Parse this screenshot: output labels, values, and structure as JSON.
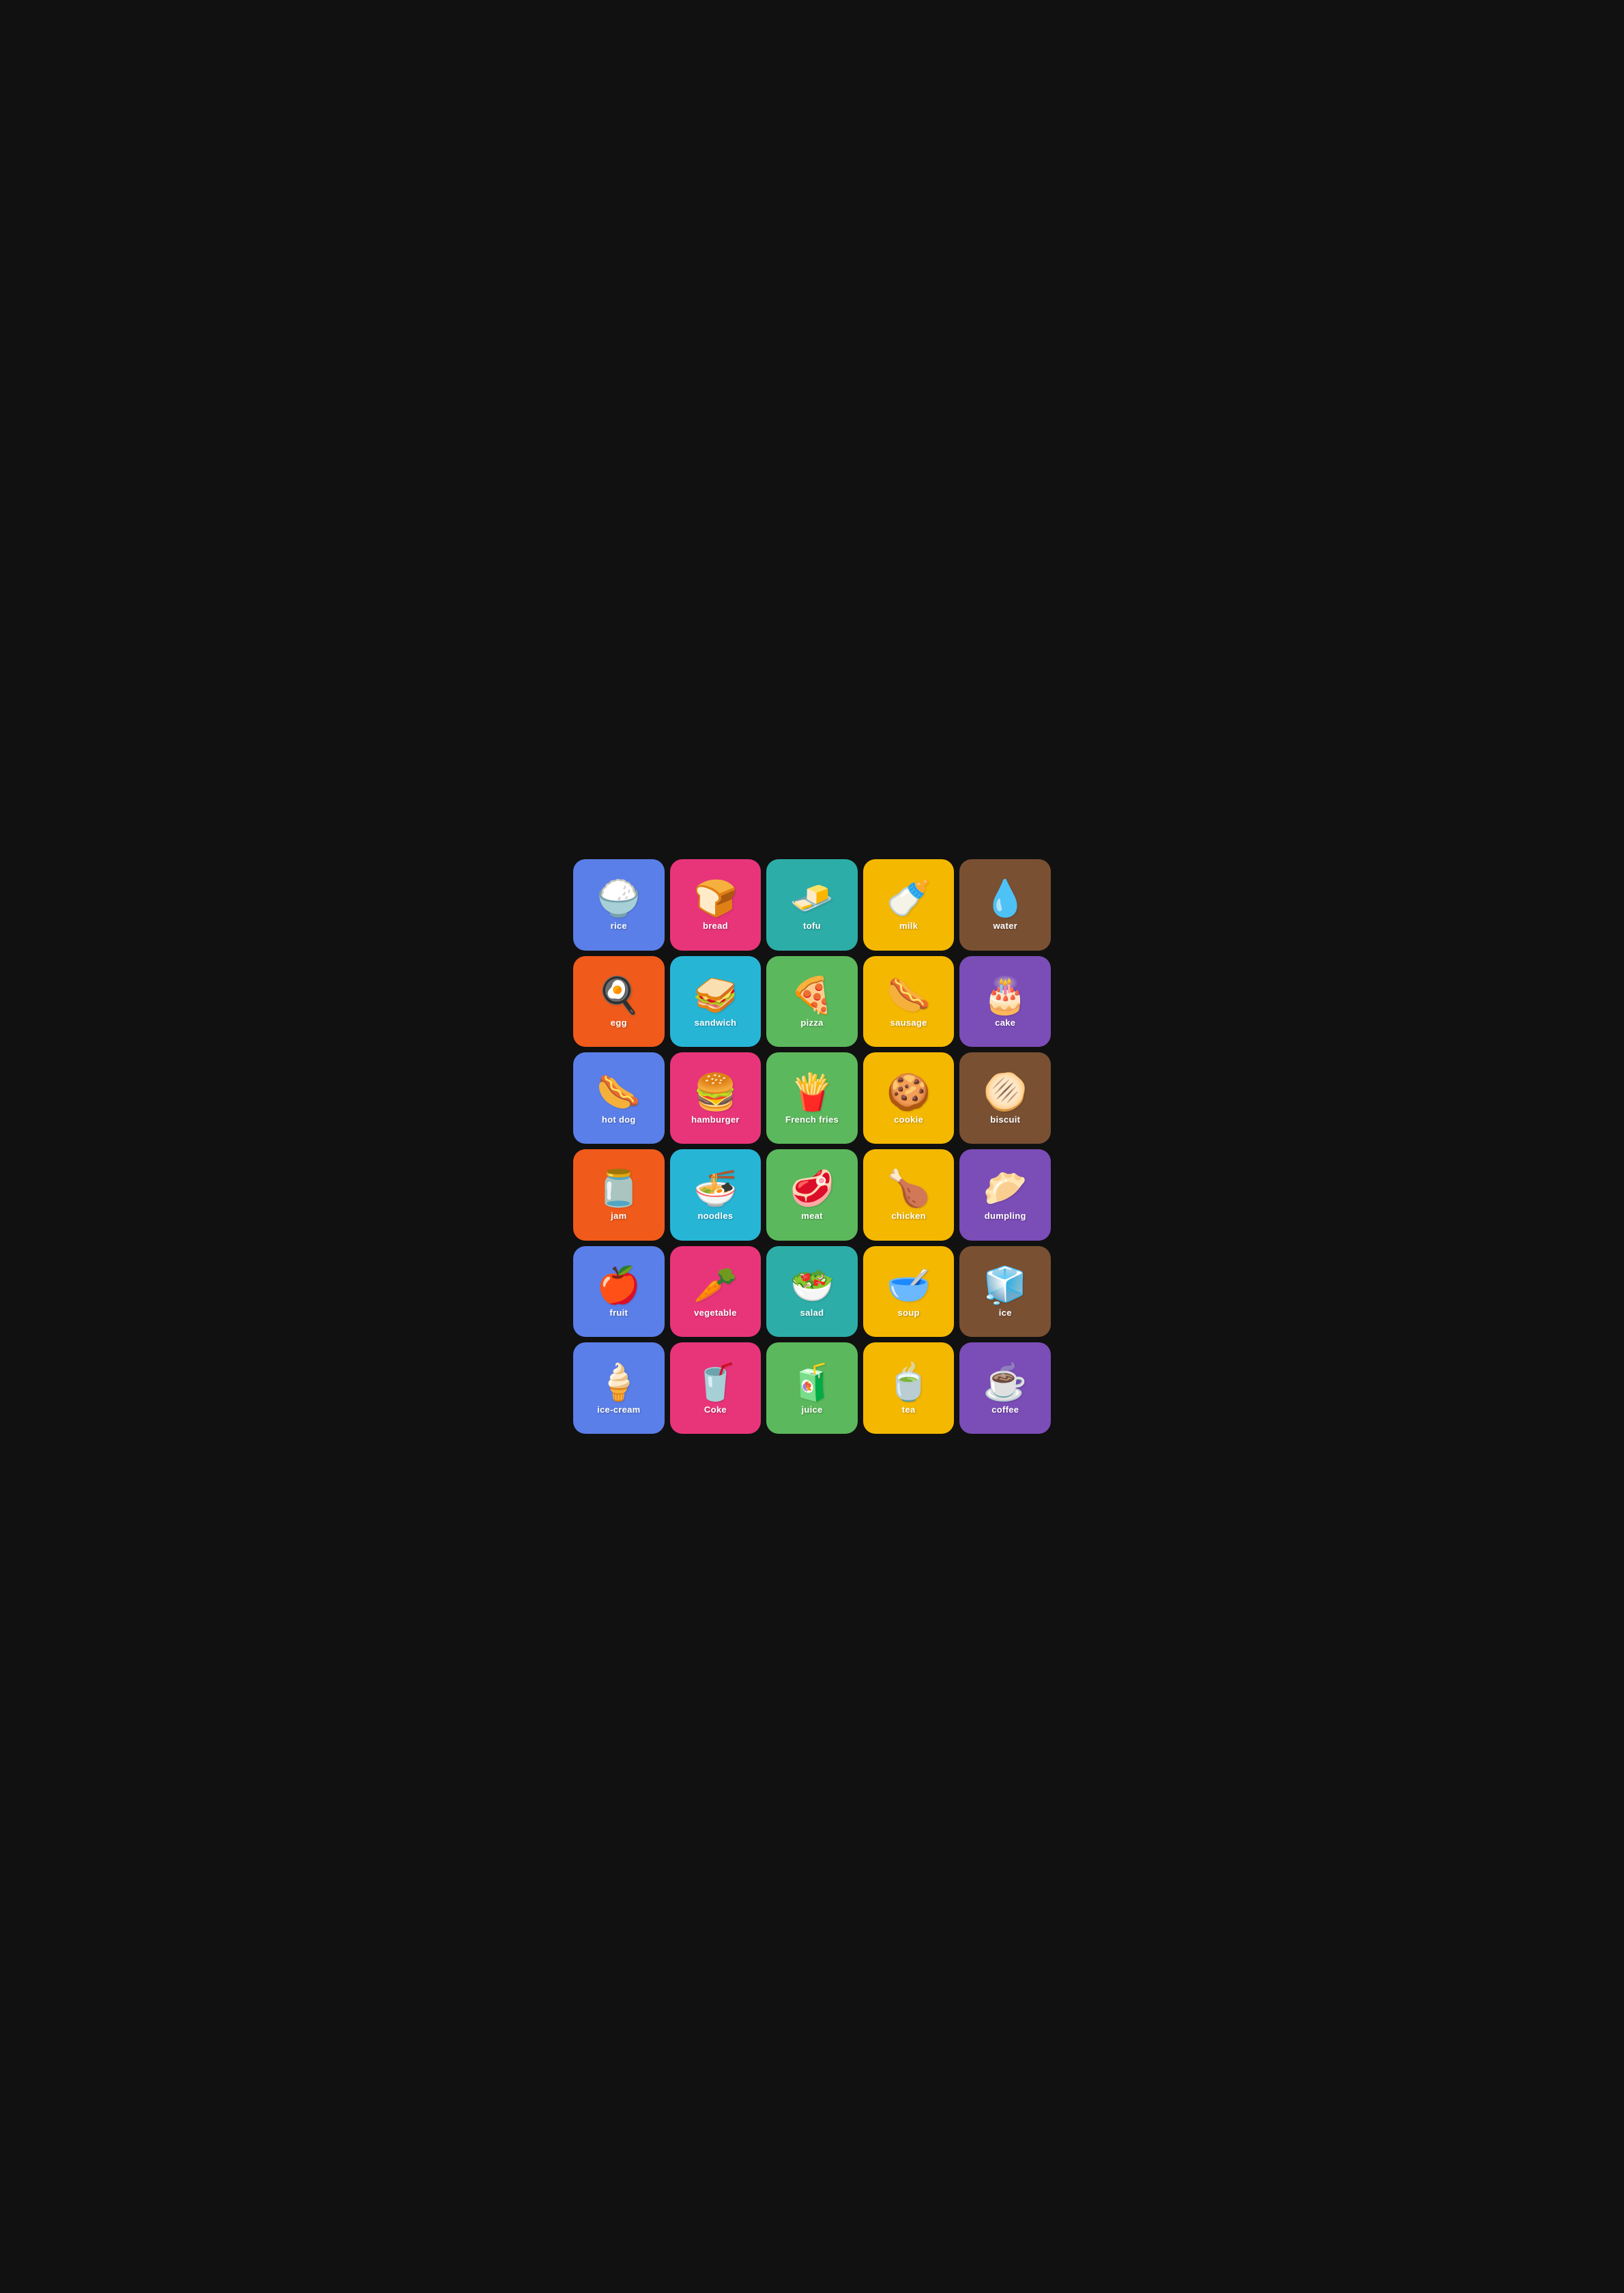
{
  "cards": [
    {
      "id": "rice",
      "label": "rice",
      "icon": "🍚",
      "bg": "bg-blue"
    },
    {
      "id": "bread",
      "label": "bread",
      "icon": "🍞",
      "bg": "bg-pink"
    },
    {
      "id": "tofu",
      "label": "tofu",
      "icon": "🧈",
      "bg": "bg-teal"
    },
    {
      "id": "milk",
      "label": "milk",
      "icon": "🍼",
      "bg": "bg-yellow"
    },
    {
      "id": "water",
      "label": "water",
      "icon": "💧",
      "bg": "bg-brown"
    },
    {
      "id": "egg",
      "label": "egg",
      "icon": "🍳",
      "bg": "bg-orange"
    },
    {
      "id": "sandwich",
      "label": "sandwich",
      "icon": "🥪",
      "bg": "bg-cyan"
    },
    {
      "id": "pizza",
      "label": "pizza",
      "icon": "🍕",
      "bg": "bg-green"
    },
    {
      "id": "sausage",
      "label": "sausage",
      "icon": "🌭",
      "bg": "bg-yellow"
    },
    {
      "id": "cake",
      "label": "cake",
      "icon": "🎂",
      "bg": "bg-purple"
    },
    {
      "id": "hot-dog",
      "label": "hot dog",
      "icon": "🌭",
      "bg": "bg-blue"
    },
    {
      "id": "hamburger",
      "label": "hamburger",
      "icon": "🍔",
      "bg": "bg-pink"
    },
    {
      "id": "french-fries",
      "label": "French fries",
      "icon": "🍟",
      "bg": "bg-green"
    },
    {
      "id": "cookie",
      "label": "cookie",
      "icon": "🍪",
      "bg": "bg-yellow"
    },
    {
      "id": "biscuit",
      "label": "biscuit",
      "icon": "🫓",
      "bg": "bg-brown"
    },
    {
      "id": "jam",
      "label": "jam",
      "icon": "🫙",
      "bg": "bg-orange"
    },
    {
      "id": "noodles",
      "label": "noodles",
      "icon": "🍜",
      "bg": "bg-cyan"
    },
    {
      "id": "meat",
      "label": "meat",
      "icon": "🥩",
      "bg": "bg-green"
    },
    {
      "id": "chicken",
      "label": "chicken",
      "icon": "🍗",
      "bg": "bg-yellow"
    },
    {
      "id": "dumpling",
      "label": "dumpling",
      "icon": "🥟",
      "bg": "bg-purple"
    },
    {
      "id": "fruit",
      "label": "fruit",
      "icon": "🍎",
      "bg": "bg-blue"
    },
    {
      "id": "vegetable",
      "label": "vegetable",
      "icon": "🥕",
      "bg": "bg-pink"
    },
    {
      "id": "salad",
      "label": "salad",
      "icon": "🥗",
      "bg": "bg-teal"
    },
    {
      "id": "soup",
      "label": "soup",
      "icon": "🥣",
      "bg": "bg-yellow"
    },
    {
      "id": "ice",
      "label": "ice",
      "icon": "🧊",
      "bg": "bg-brown"
    },
    {
      "id": "ice-cream",
      "label": "ice-cream",
      "icon": "🍦",
      "bg": "bg-blue"
    },
    {
      "id": "coke",
      "label": "Coke",
      "icon": "🥤",
      "bg": "bg-pink"
    },
    {
      "id": "juice",
      "label": "juice",
      "icon": "🧃",
      "bg": "bg-green"
    },
    {
      "id": "tea",
      "label": "tea",
      "icon": "🍵",
      "bg": "bg-yellow"
    },
    {
      "id": "coffee",
      "label": "coffee",
      "icon": "☕",
      "bg": "bg-lpurple"
    }
  ]
}
